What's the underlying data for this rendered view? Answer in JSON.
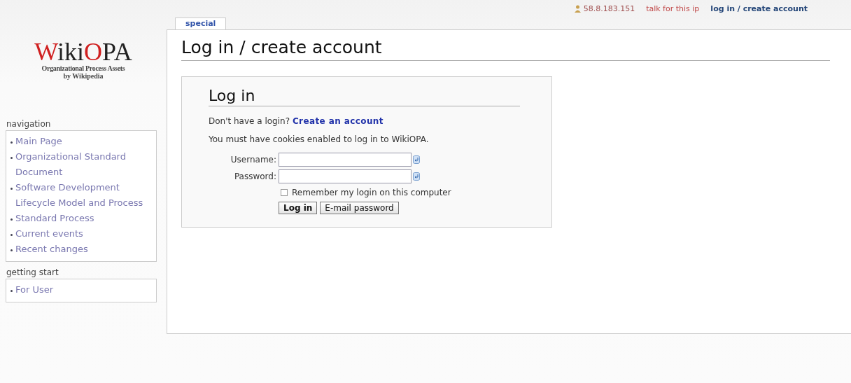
{
  "personal_bar": {
    "ip": "58.8.183.151",
    "talk": "talk for this ip",
    "login": "log in / create account"
  },
  "logo": {
    "title_w": "W",
    "title_iki": "iki",
    "title_o": "O",
    "title_pa": "PA",
    "subtitle": "Organizational Process Assets",
    "byline": "by Wikipedia"
  },
  "tabs": [
    {
      "label": "special",
      "selected": true
    }
  ],
  "page_title": "Log in / create account",
  "sidebar": [
    {
      "heading": "navigation",
      "items": [
        "Main Page",
        "Organizational Standard Document",
        "Software Development Lifecycle Model and Process",
        "Standard Process",
        "Current events",
        "Recent changes"
      ]
    },
    {
      "heading": "getting start",
      "items": [
        "For User"
      ]
    }
  ],
  "login_box": {
    "heading": "Log in",
    "no_login_text": "Don't have a login?",
    "create_link": "Create an account",
    "cookies_note": "You must have cookies enabled to log in to WikiOPA.",
    "username_label": "Username:",
    "password_label": "Password:",
    "remember": {
      "label": "Remember my login on this computer",
      "checked": false
    },
    "buttons": [
      "Log in",
      "E-mail password"
    ]
  }
}
